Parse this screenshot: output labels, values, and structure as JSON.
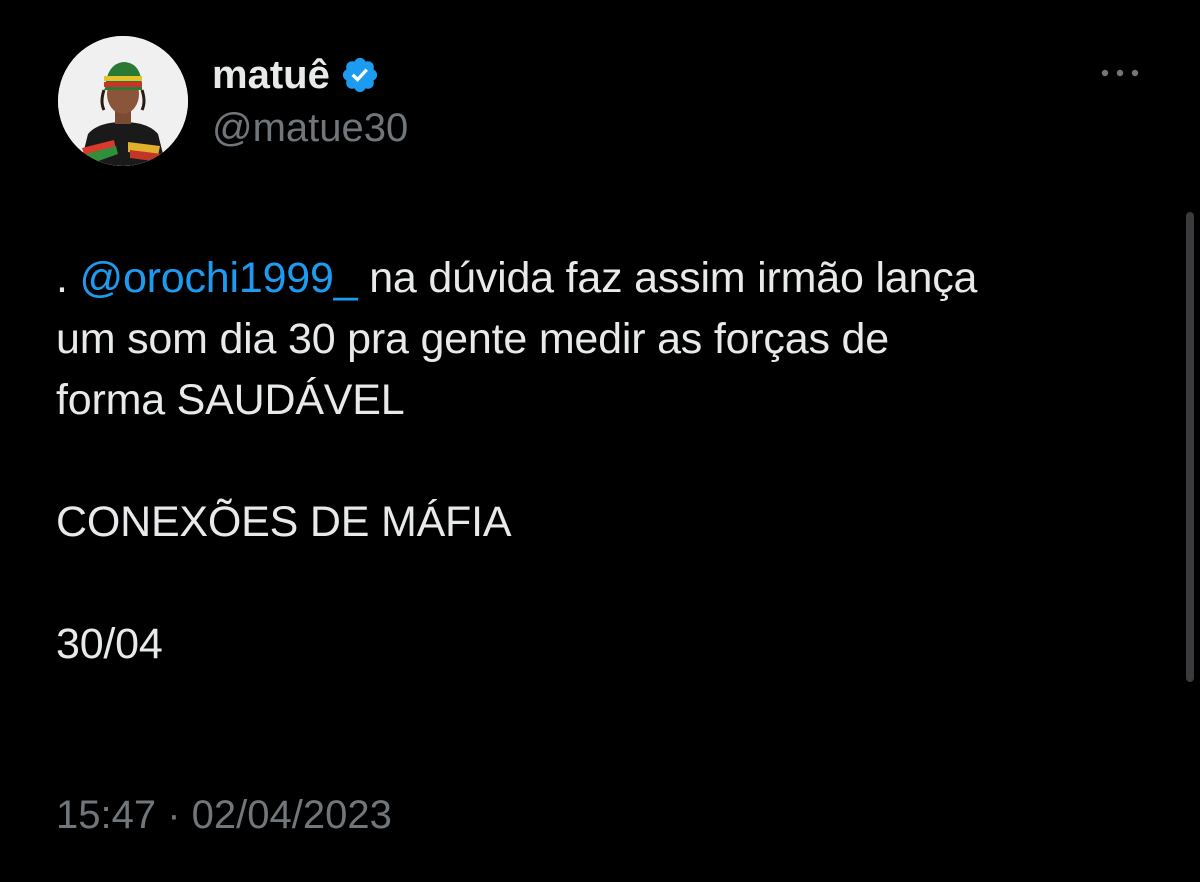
{
  "author": {
    "display_name": "matuê",
    "handle": "@matue30",
    "verified": true,
    "avatar_icon": "profile-photo"
  },
  "post": {
    "prefix": ". ",
    "mention": "@orochi1999_",
    "line1_rest": " na dúvida faz assim irmão lança",
    "line2": "um som dia 30 pra gente medir as forças de",
    "line3": "forma SAUDÁVEL",
    "line4": "CONEXÕES DE MÁFIA",
    "line5": "30/04"
  },
  "meta": {
    "time": "15:47",
    "separator": " · ",
    "date": "02/04/2023"
  },
  "icons": {
    "more": "more-horizontal-icon",
    "verified": "verified-badge-icon"
  },
  "colors": {
    "background": "#000000",
    "text": "#e7e9ea",
    "secondary": "#71767b",
    "accent": "#1d9bf0"
  }
}
